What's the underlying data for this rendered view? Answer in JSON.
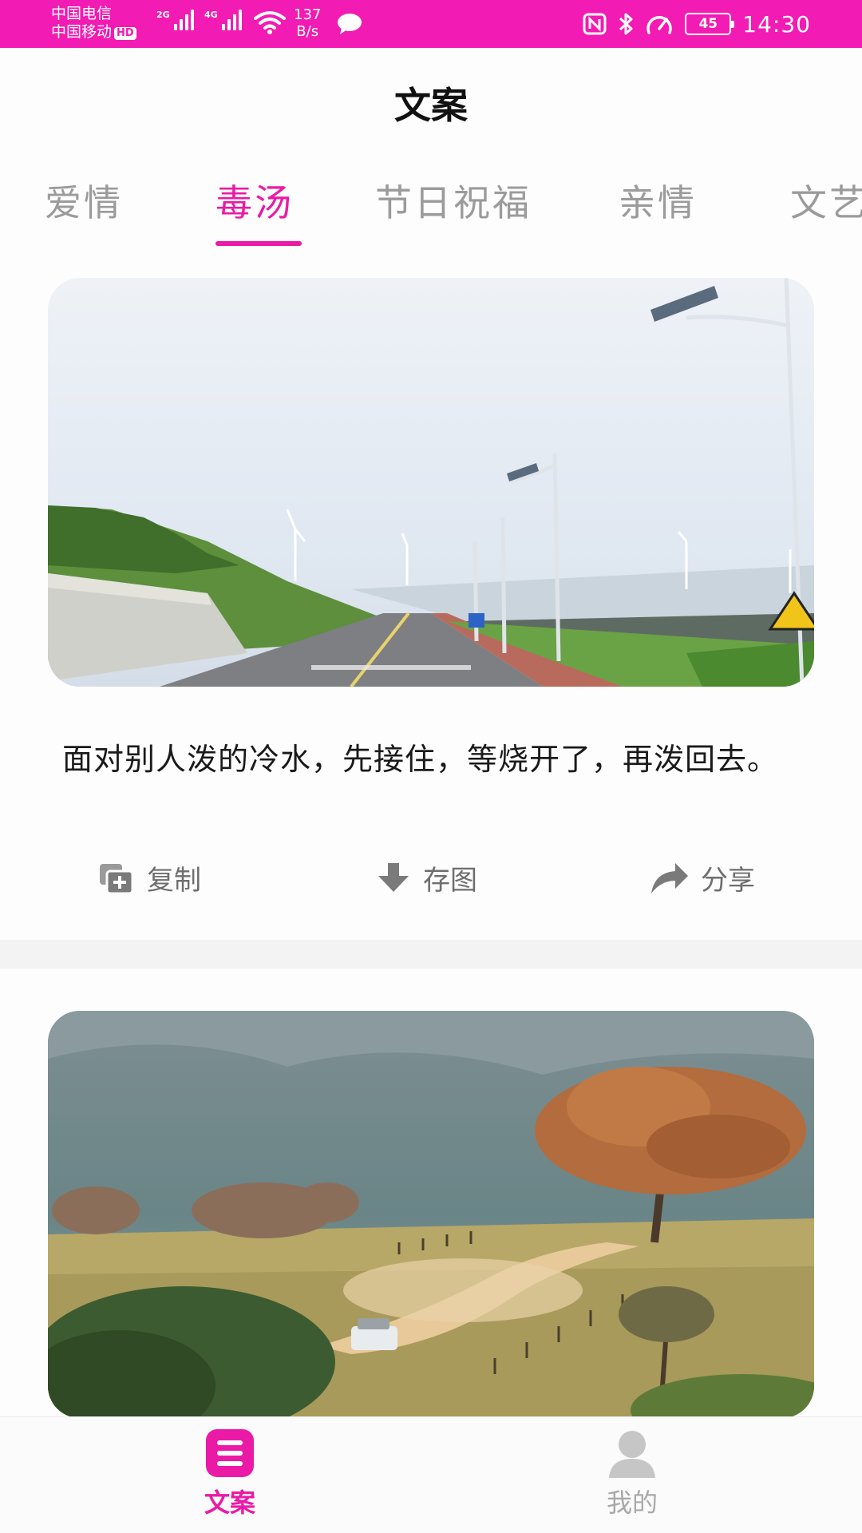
{
  "status_bar": {
    "carrier_1": "中国电信",
    "carrier_2": "中国移动",
    "hd_badge": "HD",
    "signal_1_tag": "2G",
    "signal_2_tag": "4G",
    "net_speed_value": "137",
    "net_speed_unit": "B/s",
    "battery_level": "45",
    "time": "14:30",
    "icons": [
      "signal-icon",
      "wifi-icon",
      "message-icon",
      "nfc-icon",
      "bluetooth-icon",
      "speedometer-icon",
      "battery-icon"
    ]
  },
  "header": {
    "title": "文案"
  },
  "tabs": [
    {
      "label": "爱情",
      "active": false
    },
    {
      "label": "毒汤",
      "active": true
    },
    {
      "label": "节日祝福",
      "active": false
    },
    {
      "label": "亲情",
      "active": false
    },
    {
      "label": "文艺",
      "active": false
    }
  ],
  "cards": [
    {
      "quote": "面对别人泼的冷水，先接住，等烧开了，再泼回去。",
      "actions": [
        {
          "label": "复制",
          "icon": "copy-icon"
        },
        {
          "label": "存图",
          "icon": "download-icon"
        },
        {
          "label": "分享",
          "icon": "share-icon"
        }
      ]
    }
  ],
  "bottom_nav": [
    {
      "label": "文案",
      "icon": "document-list-icon",
      "active": true
    },
    {
      "label": "我的",
      "icon": "user-icon",
      "active": false
    }
  ],
  "colors": {
    "accent": "#ea1aa6",
    "status_bar": "#f21bb3",
    "tab_inactive": "#9b9b9b",
    "action_text": "#6e6e6e"
  }
}
